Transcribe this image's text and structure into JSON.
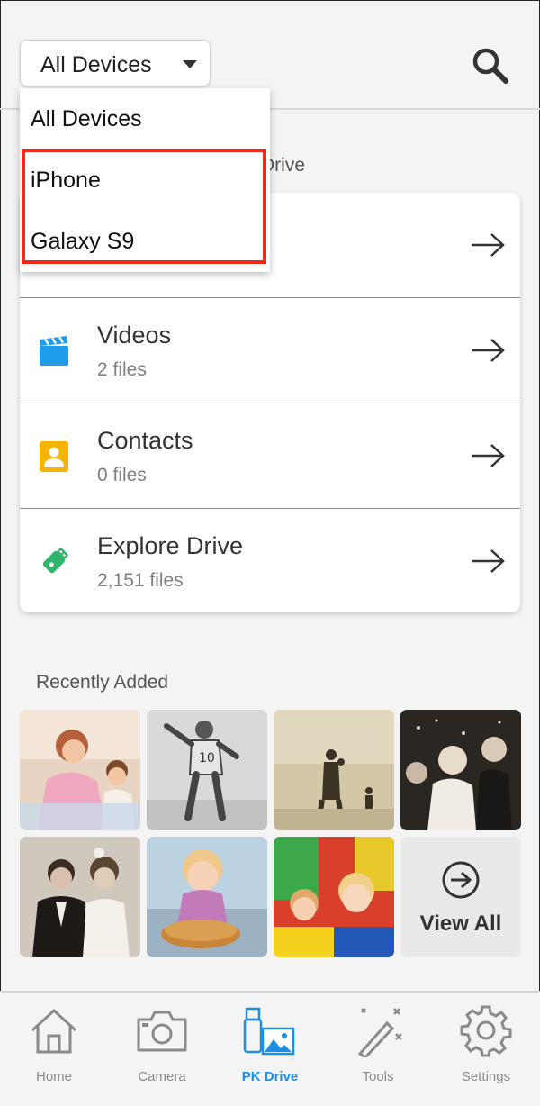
{
  "header": {
    "device_select_value": "All Devices"
  },
  "section": {
    "title_visible_fragment": "Drive"
  },
  "categories": [
    {
      "title": "",
      "count": "",
      "icon": "photos-icon"
    },
    {
      "title": "Videos",
      "count": "2 files",
      "icon": "video-clapper-icon"
    },
    {
      "title": "Contacts",
      "count": "0 files",
      "icon": "contact-card-icon"
    },
    {
      "title": "Explore Drive",
      "count": "2,151 files",
      "icon": "usb-drive-icon"
    }
  ],
  "dropdown": {
    "options": [
      "All Devices",
      "iPhone",
      "Galaxy S9"
    ],
    "highlight_color": "#ee2a1a"
  },
  "recent": {
    "title": "Recently Added",
    "view_all_label": "View All"
  },
  "tabs": [
    {
      "label": "Home",
      "icon": "home-icon",
      "active": false
    },
    {
      "label": "Camera",
      "icon": "camera-icon",
      "active": false
    },
    {
      "label": "PK Drive",
      "icon": "pk-drive-icon",
      "active": true
    },
    {
      "label": "Tools",
      "icon": "magic-wand-icon",
      "active": false
    },
    {
      "label": "Settings",
      "icon": "gear-icon",
      "active": false
    }
  ],
  "colors": {
    "accent": "#1a8fe3",
    "video_icon": "#1e9be9",
    "contact_icon": "#f5b400",
    "drive_icon": "#2fb56a"
  }
}
